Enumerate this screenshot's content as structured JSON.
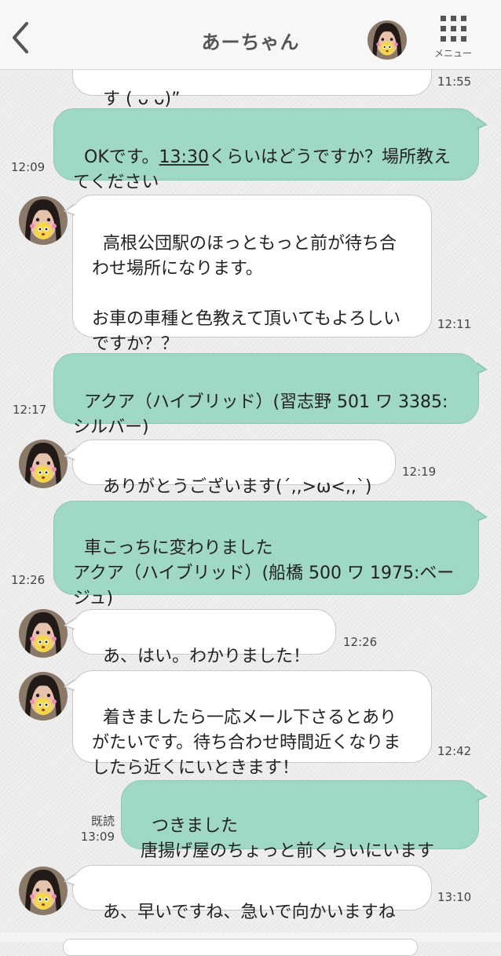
{
  "header": {
    "title": "あーちゃん",
    "menu_label": "メニュー"
  },
  "messages": [
    {
      "id": "m0",
      "side": "in",
      "text": "す ( ᴗ ᴗ)”",
      "time": "11:55"
    },
    {
      "id": "m1",
      "side": "out",
      "text_pre": "OKです。",
      "text_link": "13:30",
      "text_post": "くらいはどうですか？場所教えてください",
      "time": "12:09"
    },
    {
      "id": "m2",
      "side": "in",
      "text": "高根公団駅のほっともっと前が待ち合わせ場所になります。\n\nお車の車種と色教えて頂いてもよろしいですか？？",
      "time": "12:11"
    },
    {
      "id": "m3",
      "side": "out",
      "text": "アクア（ハイブリッド）(習志野 501 ワ 3385:シルバー)",
      "time": "12:17"
    },
    {
      "id": "m4",
      "side": "in",
      "text": "ありがとうございます(´,,>ω<,,`)",
      "time": "12:19"
    },
    {
      "id": "m5",
      "side": "out",
      "text": "車こっちに変わりました\nアクア（ハイブリッド）(船橋 500 ワ 1975:ベージュ)",
      "time": "12:26"
    },
    {
      "id": "m6",
      "side": "in",
      "text": "あ、はい。わかりました！",
      "time": "12:26"
    },
    {
      "id": "m7",
      "side": "in",
      "text": "着きましたら一応メール下さるとありがたいです。待ち合わせ時間近くなりましたら近くにいときます！",
      "time": "12:42"
    },
    {
      "id": "m8",
      "side": "out",
      "text": "つきました\n唐揚げ屋のちょっと前くらいにいます",
      "time": "13:09",
      "read": "既読"
    },
    {
      "id": "m9",
      "side": "in",
      "text": "あ、早いですね、急いで向かいますね",
      "time": "13:10"
    }
  ]
}
